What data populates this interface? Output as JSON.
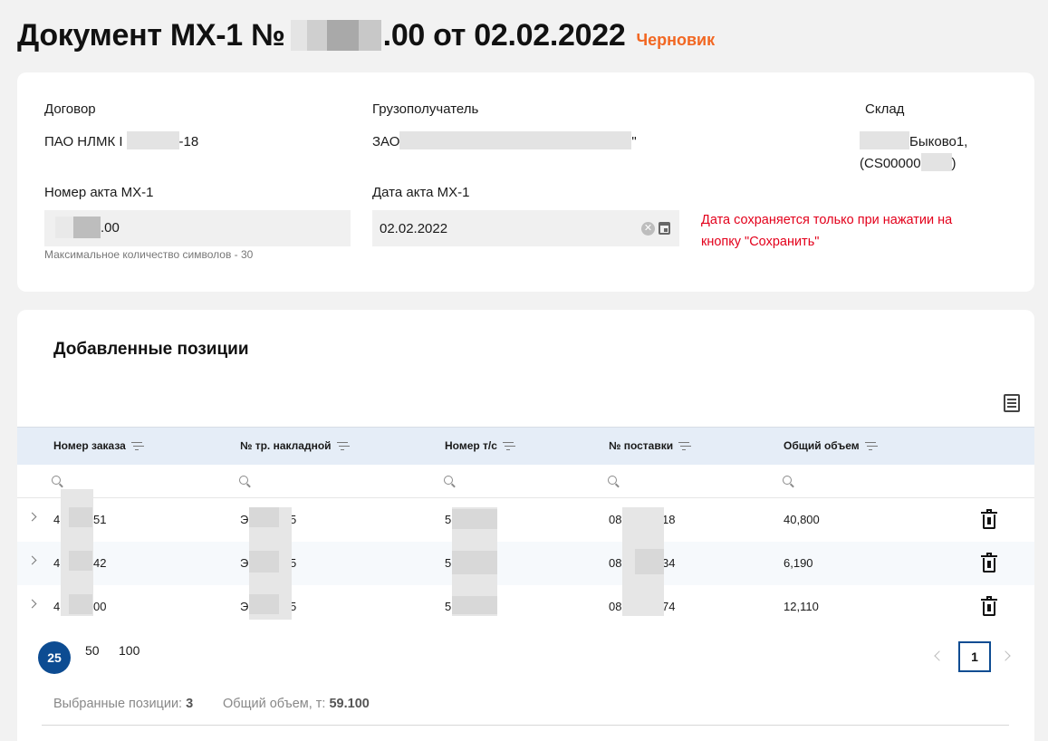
{
  "header": {
    "title_prefix": "Документ МХ-1 №",
    "title_suffix": ".00 от 02.02.2022",
    "status": "Черновик"
  },
  "details": {
    "contract_label": "Договор",
    "contract_value_start": "ПАО НЛМК I",
    "contract_value_end": "-18",
    "consignee_label": "Грузополучатель",
    "consignee_value_start": "ЗАО",
    "consignee_value_end": "\"",
    "warehouse_label": "Склад",
    "warehouse_line1_end": "Быково1,",
    "warehouse_line2_start": "(CS00000",
    "warehouse_line2_end": ")",
    "act_number_label": "Номер акта МХ-1",
    "act_number_value": ".00",
    "act_number_hint": "Максимальное количество символов - 30",
    "act_date_label": "Дата акта МХ-1",
    "act_date_value": "02.02.2022",
    "date_warning": "Дата сохраняется только при нажатии на кнопку \"Сохранить\""
  },
  "positions": {
    "title": "Добавленные позиции",
    "columns": [
      "Номер заказа",
      "№ тр. накладной",
      "Номер т/с",
      "№ поставки",
      "Общий объем"
    ],
    "rows": [
      {
        "order_start": "4",
        "order_end": "51",
        "waybill_start": "Э",
        "waybill_end": "5",
        "vehicle_start": "5",
        "delivery_start": "08",
        "delivery_end": "18",
        "volume": "40,800"
      },
      {
        "order_start": "4",
        "order_end": "42",
        "waybill_start": "Э",
        "waybill_end": "5",
        "vehicle_start": "5",
        "delivery_start": "08",
        "delivery_end": "34",
        "volume": "6,190"
      },
      {
        "order_start": "4",
        "order_end": "00",
        "waybill_start": "Э",
        "waybill_end": "5",
        "vehicle_start": "5",
        "delivery_start": "08",
        "delivery_end": "74",
        "volume": "12,110"
      }
    ]
  },
  "pagination": {
    "page_sizes": [
      "25",
      "50",
      "100"
    ],
    "current_page": "1"
  },
  "summary": {
    "selected_label": "Выбранные позиции:",
    "selected_count": "3",
    "volume_label": "Общий объем, т:",
    "volume_value": "59.100"
  }
}
